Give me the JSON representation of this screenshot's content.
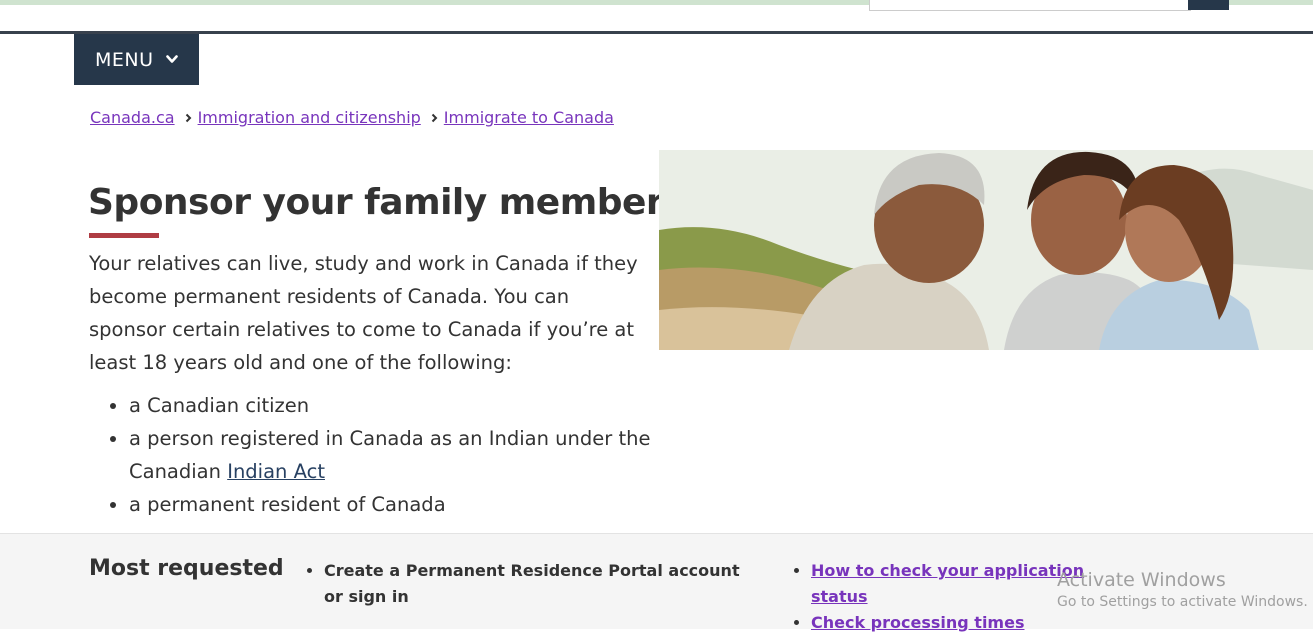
{
  "header": {
    "menu_label": "MENU"
  },
  "breadcrumb": [
    {
      "label": "Canada.ca"
    },
    {
      "label": "Immigration and citizenship"
    },
    {
      "label": "Immigrate to Canada"
    }
  ],
  "main": {
    "title": "Sponsor your family members",
    "intro": "Your relatives can live, study and work in Canada if they become permanent residents of Canada. You can sponsor certain relatives to come to Canada if you’re at least 18 years old and one of the following:",
    "bullets": {
      "item1": "a Canadian citizen",
      "item2_prefix": "a person registered in Canada as an Indian under the Canadian",
      "item2_link": "Indian Act",
      "item3": "a permanent resident of Canada"
    }
  },
  "most_requested": {
    "title": "Most requested",
    "items_col1": [
      "Create a Permanent Residence Portal account or sign in"
    ],
    "items_col2": [
      "How to check your application status",
      "Check processing times"
    ]
  },
  "watermark": {
    "line1": "Activate Windows",
    "line2": "Go to Settings to activate Windows."
  },
  "colors": {
    "menu_bg": "#26374a",
    "link_visited": "#7834bc",
    "title_underline": "#af3c43"
  }
}
